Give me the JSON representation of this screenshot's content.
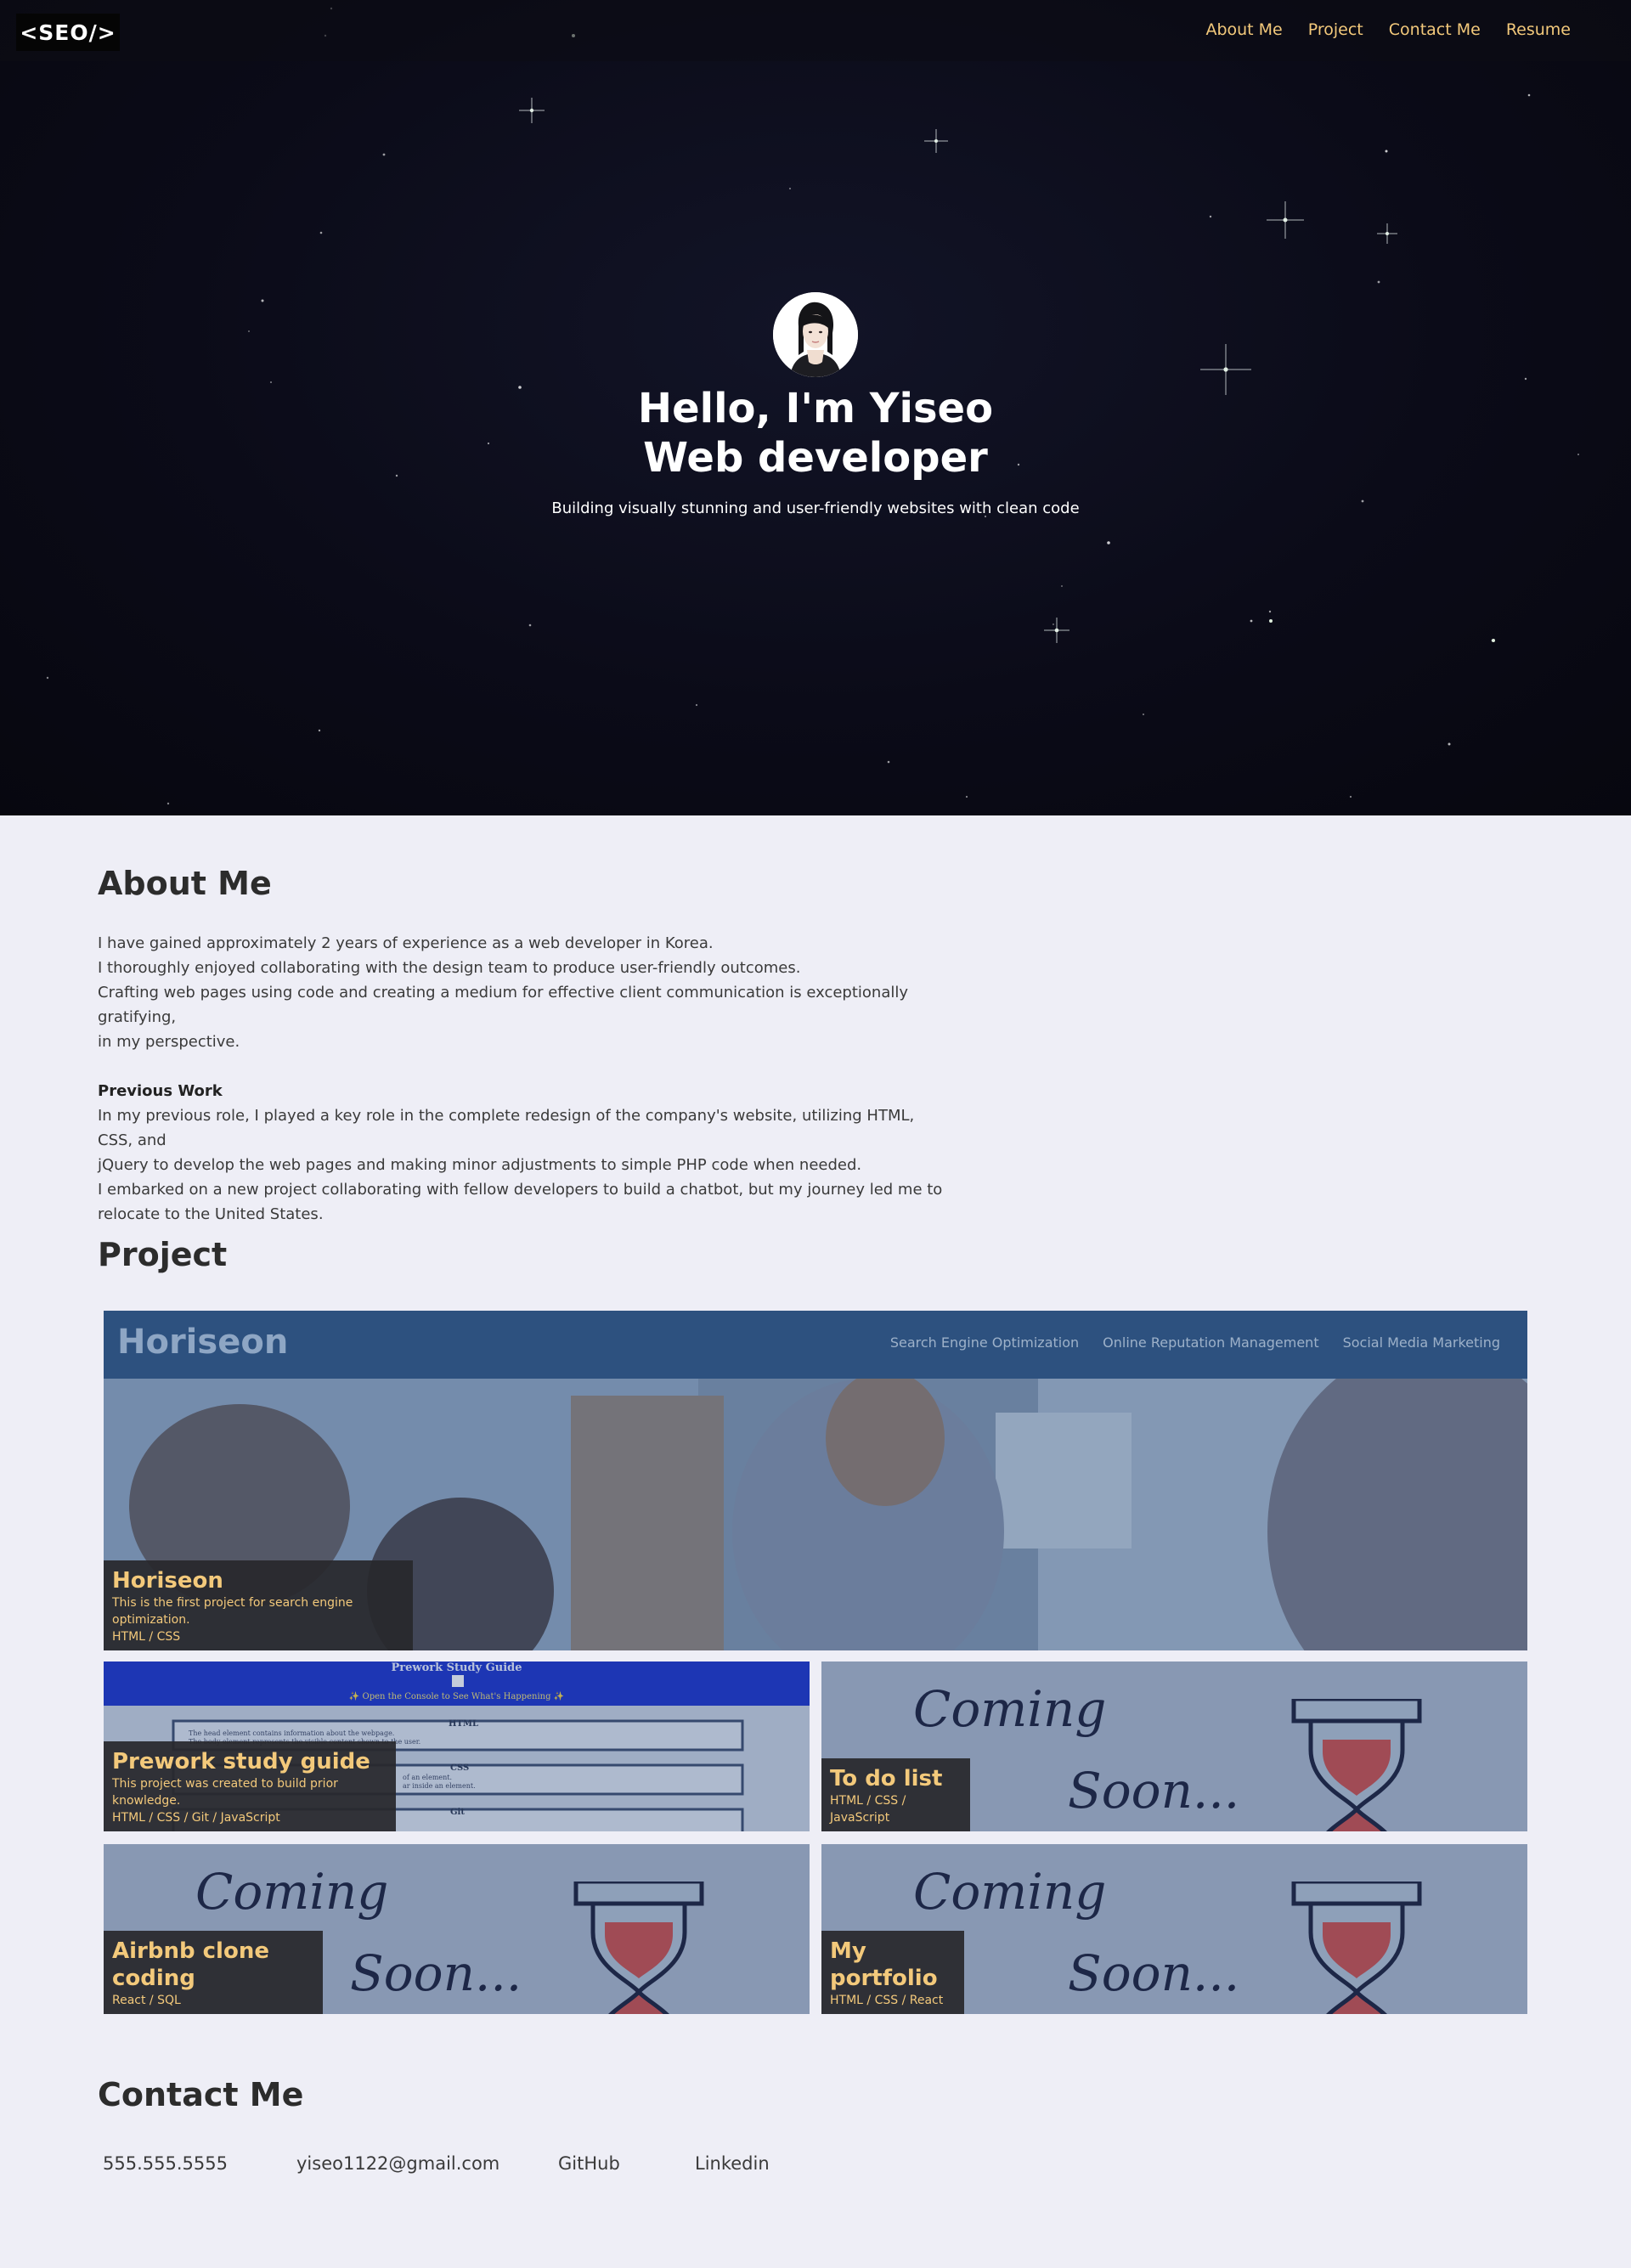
{
  "header": {
    "logo": "<SEO/>",
    "nav": [
      "About Me",
      "Project",
      "Contact Me",
      "Resume"
    ]
  },
  "hero": {
    "title_line1": "Hello, I'm Yiseo",
    "title_line2": "Web developer",
    "subtitle": "Building visually stunning and user-friendly websites with clean code"
  },
  "about": {
    "heading": "About Me",
    "paragraph1": [
      "I have gained approximately 2 years of experience as a web developer in Korea.",
      "I thoroughly enjoyed collaborating with the design team to produce user-friendly outcomes.",
      "Crafting web pages using code and creating a medium for effective client communication is exceptionally gratifying,",
      "in my perspective."
    ],
    "subheading": "Previous Work",
    "paragraph2": [
      "In my previous role, I played a key role in the complete redesign of the company's website, utilizing HTML, CSS, and",
      "jQuery to develop the web pages and making minor adjustments to simple PHP code when needed.",
      "I embarked on a new project collaborating with fellow developers to build a chatbot, but my journey led me to",
      "relocate to the United States."
    ]
  },
  "projects": {
    "heading": "Project",
    "horiseon": {
      "screenshot_brand": "Horiseon",
      "screenshot_nav": [
        "Search Engine Optimization",
        "Online Reputation Management",
        "Social Media Marketing"
      ],
      "title": "Horiseon",
      "description": "This is the first project for search engine optimization.",
      "tech": "HTML / CSS"
    },
    "prework": {
      "screenshot_title": "Prework Study Guide",
      "screenshot_banner": "✨ Open the Console to See What's Happening ✨",
      "screenshot_sections": [
        "HTML",
        "CSS",
        "Git"
      ],
      "screenshot_lines": [
        "The head element contains information about the webpage.",
        "The body element represents the visible content shown to the user.",
        "of an element.",
        "ar inside an element."
      ],
      "title": "Prework study guide",
      "description": "This project was created to build prior knowledge.",
      "tech": "HTML / CSS / Git / JavaScript"
    },
    "todo": {
      "title": "To do list",
      "tech": "HTML / CSS / JavaScript"
    },
    "airbnb": {
      "title": "Airbnb clone coding",
      "tech": "React / SQL"
    },
    "portfolio": {
      "title": "My portfolio",
      "tech": "HTML / CSS / React"
    },
    "coming_soon_line1": "Coming",
    "coming_soon_line2": "Soon..."
  },
  "contact": {
    "heading": "Contact Me",
    "phone": "555.555.5555",
    "email": "yiseo1122@gmail.com",
    "github": "GitHub",
    "linkedin": "Linkedin"
  },
  "colors": {
    "accent": "#f3c97b",
    "page_bg": "#eeeef6",
    "hero_bg": "#0b0b18",
    "caption_bg": "#28282c"
  }
}
